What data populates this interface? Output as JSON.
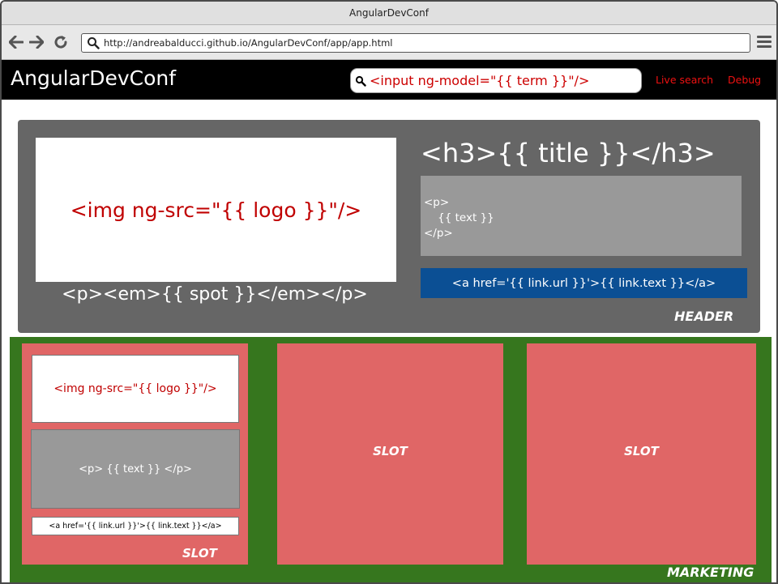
{
  "window": {
    "title": "AngularDevConf"
  },
  "toolbar": {
    "url": "http://andreabalducci.github.io/AngularDevConf/app/app.html",
    "back_icon": "back-arrow-icon",
    "forward_icon": "forward-arrow-icon",
    "reload_icon": "reload-icon",
    "menu_icon": "hamburger-menu-icon"
  },
  "navbar": {
    "brand": "AngularDevConf",
    "search_placeholder": "<input ng-model=\"{{ term }}\"/>",
    "links": [
      "Live search",
      "Debug"
    ]
  },
  "header": {
    "img": "<img ng-src=\"{{ logo }}\"/>",
    "spot": "<p><em>{{ spot }}</em></p>",
    "title": "<h3>{{ title }}</h3>",
    "text": "<p>\n    {{ text }}\n</p>",
    "link": "<a href='{{ link.url }}'>{{ link.text }}</a>",
    "label": "HEADER"
  },
  "marketing": {
    "label": "MARKETING",
    "slot1": {
      "img": "<img ng-src=\"{{ logo }}\"/>",
      "text": "<p> {{ text }} </p>",
      "link": "<a href='{{ link.url }}'>{{ link.text }}</a>",
      "label": "SLOT"
    },
    "slot2": {
      "label": "SLOT"
    },
    "slot3": {
      "label": "SLOT"
    }
  },
  "colors": {
    "navbar": "#000000",
    "header_bg": "#666666",
    "marketing_bg": "#36761e",
    "slot_bg": "#e06666",
    "link_bg": "#0b4f94",
    "accent_red": "#cc0000"
  }
}
